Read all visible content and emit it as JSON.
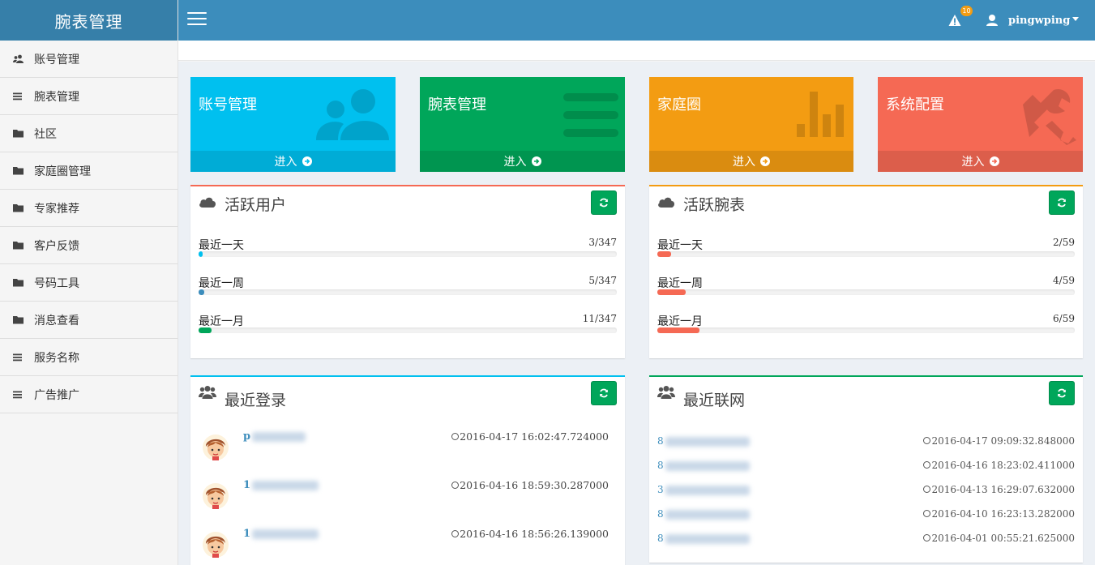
{
  "sidebar": {
    "brand": "腕表管理",
    "items": [
      {
        "label": "账号管理",
        "icon": "users-icon"
      },
      {
        "label": "腕表管理",
        "icon": "list-icon"
      },
      {
        "label": "社区",
        "icon": "folder-icon"
      },
      {
        "label": "家庭圈管理",
        "icon": "folder-icon"
      },
      {
        "label": "专家推荐",
        "icon": "folder-icon"
      },
      {
        "label": "客户反馈",
        "icon": "folder-icon"
      },
      {
        "label": "号码工具",
        "icon": "folder-icon"
      },
      {
        "label": "消息查看",
        "icon": "folder-icon"
      },
      {
        "label": "服务名称",
        "icon": "list-icon"
      },
      {
        "label": "广告推广",
        "icon": "list-icon"
      }
    ]
  },
  "topbar": {
    "alert_count": "10",
    "username": "pingwping"
  },
  "tiles": [
    {
      "title": "账号管理",
      "footer": "进入",
      "color": "#00c0ef",
      "icon": "users-icon"
    },
    {
      "title": "腕表管理",
      "footer": "进入",
      "color": "#00a65a",
      "icon": "list-icon"
    },
    {
      "title": "家庭圈",
      "footer": "进入",
      "color": "#f39c12",
      "icon": "bar-chart-icon"
    },
    {
      "title": "系统配置",
      "footer": "进入",
      "color": "#f56954",
      "icon": "tools-icon"
    }
  ],
  "active_users": {
    "title": "活跃用户",
    "accent": "#f56954",
    "stats": [
      {
        "label": "最近一天",
        "count": "3/347",
        "fraction": 0.0086,
        "color": "#00c0ef"
      },
      {
        "label": "最近一周",
        "count": "5/347",
        "fraction": 0.0144,
        "color": "#3c8dbc"
      },
      {
        "label": "最近一月",
        "count": "11/347",
        "fraction": 0.0317,
        "color": "#00a65a"
      }
    ]
  },
  "active_watches": {
    "title": "活跃腕表",
    "accent": "#f39c12",
    "stats": [
      {
        "label": "最近一天",
        "count": "2/59",
        "fraction": 0.0339,
        "color": "#f56954"
      },
      {
        "label": "最近一周",
        "count": "4/59",
        "fraction": 0.0678,
        "color": "#f56954"
      },
      {
        "label": "最近一月",
        "count": "6/59",
        "fraction": 0.1017,
        "color": "#f56954"
      }
    ]
  },
  "recent_logins": {
    "title": "最近登录",
    "accent": "#00c0ef",
    "rows": [
      {
        "user": "p",
        "time": "2016-04-17 16:02:47.724000"
      },
      {
        "user": "1",
        "time": "2016-04-16 18:59:30.287000"
      },
      {
        "user": "1",
        "time": "2016-04-16 18:56:26.139000"
      }
    ]
  },
  "recent_network": {
    "title": "最近联网",
    "accent": "#00a65a",
    "rows": [
      {
        "id": "8",
        "time": "2016-04-17 09:09:32.848000"
      },
      {
        "id": "8",
        "time": "2016-04-16 18:23:02.411000"
      },
      {
        "id": "3",
        "time": "2016-04-13 16:29:07.632000"
      },
      {
        "id": "8",
        "time": "2016-04-10 16:23:13.282000"
      },
      {
        "id": "8",
        "time": "2016-04-01 00:55:21.625000"
      }
    ]
  }
}
